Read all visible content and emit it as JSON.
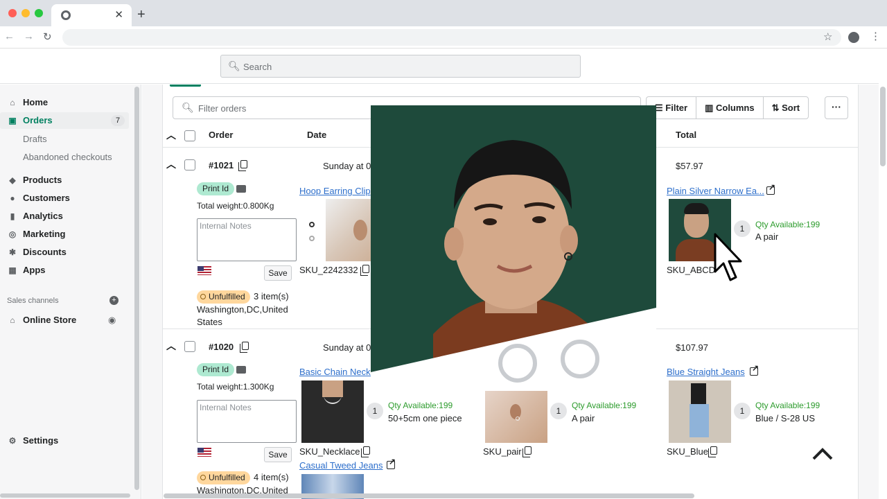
{
  "browser": {
    "tab_close": "✕",
    "new_tab": "+"
  },
  "topbar": {
    "search_placeholder": "Search"
  },
  "sidebar": {
    "home": "Home",
    "orders": "Orders",
    "orders_badge": "7",
    "drafts": "Drafts",
    "abandoned": "Abandoned checkouts",
    "products": "Products",
    "customers": "Customers",
    "analytics": "Analytics",
    "marketing": "Marketing",
    "discounts": "Discounts",
    "apps": "Apps",
    "sales_channels": "Sales channels",
    "online_store": "Online Store",
    "settings": "Settings"
  },
  "toolbar": {
    "filter_placeholder": "Filter orders",
    "filter": "Filter",
    "columns": "Columns",
    "sort": "Sort",
    "more": "···"
  },
  "table": {
    "headers": {
      "order": "Order",
      "date": "Date",
      "total": "Total"
    }
  },
  "orders": [
    {
      "number": "#1021",
      "date": "Sunday at 0",
      "total": "$57.97",
      "print_id": "Print Id",
      "weight": "Total weight:0.800Kg",
      "notes_placeholder": "Internal Notes",
      "save": "Save",
      "status": "Unfulfilled",
      "items_count": "3 item(s)",
      "address_line1": "Washington,DC,United",
      "address_line2": "States",
      "items": [
        {
          "name": "Hoop Earring Clip",
          "sku": "SKU_2242332"
        },
        {
          "name": "Plain Silver Narrow Ea...",
          "qty_count": "1",
          "qty": "Qty Available:199",
          "variant": "A pair",
          "sku": "SKU_ABCD"
        }
      ]
    },
    {
      "number": "#1020",
      "date": "Sunday at 0",
      "total": "$107.97",
      "print_id": "Print Id",
      "weight": "Total weight:1.300Kg",
      "notes_placeholder": "Internal Notes",
      "save": "Save",
      "status": "Unfulfilled",
      "items_count": "4 item(s)",
      "address_line1": "Washington,DC,United",
      "items": [
        {
          "name": "Basic Chain Neckl",
          "qty_count": "1",
          "qty": "Qty Available:199",
          "variant": "50+5cm one piece",
          "sku": "SKU_Necklace"
        },
        {
          "qty_count": "1",
          "qty": "Qty Available:199",
          "variant": "A pair",
          "sku": "SKU_pair"
        },
        {
          "name": "Blue Straight Jeans",
          "qty_count": "1",
          "qty": "Qty Available:199",
          "variant": "Blue / S-28 US",
          "sku": "SKU_Blue"
        },
        {
          "name": "Casual Tweed Jeans"
        }
      ]
    }
  ],
  "colors": {
    "accent": "#008060",
    "link": "#2c6ecb",
    "qty": "#2c9b2c",
    "unfulfilled": "#ffd79d",
    "print": "#aee9d1"
  }
}
